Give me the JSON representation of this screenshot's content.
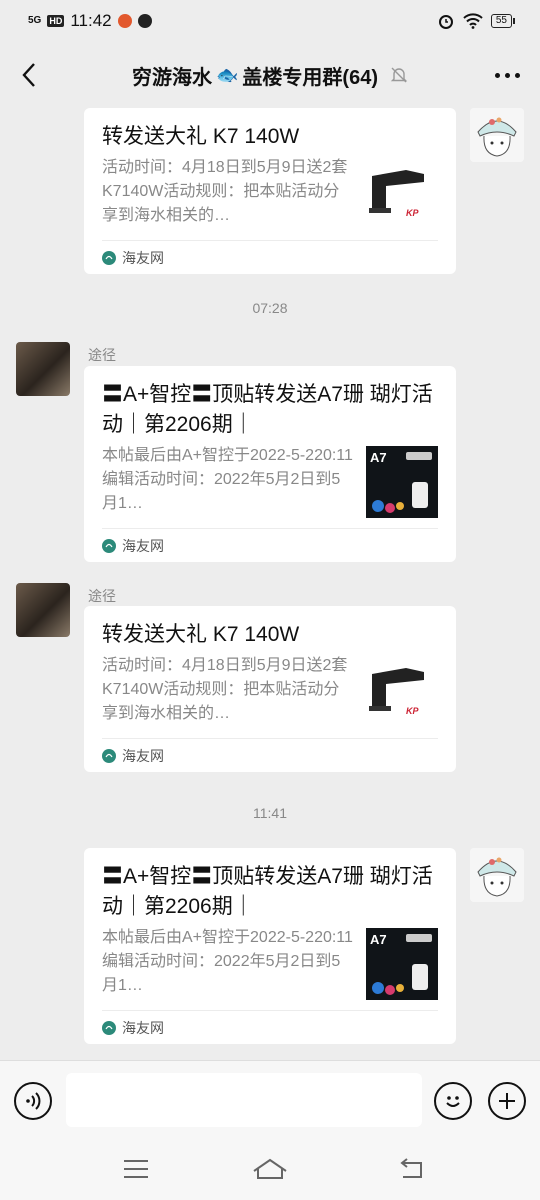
{
  "status_bar": {
    "signal": "5G",
    "hd": "HD",
    "time": "11:42",
    "battery": "55"
  },
  "header": {
    "title": "穷游海水",
    "title_suffix": "盖楼专用群(64)",
    "fish_emoji": "🐟"
  },
  "messages": [
    {
      "title": "转发送大礼 K7 140W",
      "desc": "活动时间：4月18日到5月9日送2套K7140W活动规则：把本贴活动分享到海水相关的…",
      "source": "海友网",
      "thumb_brand": "KP"
    },
    {
      "time": "07:28"
    },
    {
      "sender": "途径",
      "title": "〓A+智控〓顶贴转发送A7珊 瑚灯活动｜第2206期｜",
      "desc": "本帖最后由A+智控于2022-5-220:11编辑活动时间：2022年5月2日到5月1…",
      "source": "海友网",
      "thumb_label": "A7"
    },
    {
      "sender": "途径",
      "title": "转发送大礼 K7 140W",
      "desc": "活动时间：4月18日到5月9日送2套K7140W活动规则：把本贴活动分享到海水相关的…",
      "source": "海友网",
      "thumb_brand": "KP"
    },
    {
      "time": "11:41"
    },
    {
      "title": "〓A+智控〓顶贴转发送A7珊 瑚灯活动｜第2206期｜",
      "desc": "本帖最后由A+智控于2022-5-220:11编辑活动时间：2022年5月2日到5月1…",
      "source": "海友网",
      "thumb_label": "A7"
    }
  ],
  "colors": {
    "background": "#ededed",
    "card": "#ffffff",
    "muted_text": "#888888"
  }
}
